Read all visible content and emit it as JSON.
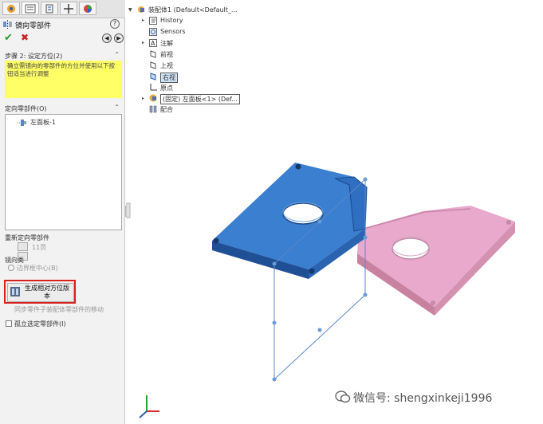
{
  "panel": {
    "header_title": "镜向零部件",
    "help_label": "?",
    "step_title": "步骤 2: 设定方位(2)",
    "message": "确立需镜向的零部件的方位并使用以下按钮适当进行调整",
    "oriented_title": "定向零部件(O)",
    "oriented_items": [
      "左面板-1"
    ],
    "reorient_title": "重新定向零部件",
    "reorient_value": "11页",
    "mirror_type_title": "镜向类",
    "bounding_center": "边界框中心(B)",
    "generate_button_label": "生成相对方位版本",
    "sync_movement": "同步零件子装配体零部件的移动",
    "isolate_label": "孤立选定零部件(I)"
  },
  "tree": {
    "root": "装配体1 (Default<Default_...",
    "items": [
      {
        "label": "History",
        "icon": "history-icon"
      },
      {
        "label": "Sensors",
        "icon": "sensor-icon"
      },
      {
        "label": "注解",
        "icon": "annotation-icon"
      },
      {
        "label": "前视",
        "icon": "plane-icon"
      },
      {
        "label": "上视",
        "icon": "plane-icon"
      },
      {
        "label": "右视",
        "icon": "plane-icon"
      },
      {
        "label": "原点",
        "icon": "origin-icon"
      },
      {
        "label": "(固定) 左面板<1> (Def...",
        "icon": "part-icon"
      },
      {
        "label": "配合",
        "icon": "mates-icon"
      }
    ]
  },
  "watermark": "微信号: shengxinkeji1996",
  "colors": {
    "blue_part": "#3a7fd0",
    "pink_part": "#e8a9cc",
    "highlight": "#d92020",
    "message_bg": "#ffff66"
  }
}
